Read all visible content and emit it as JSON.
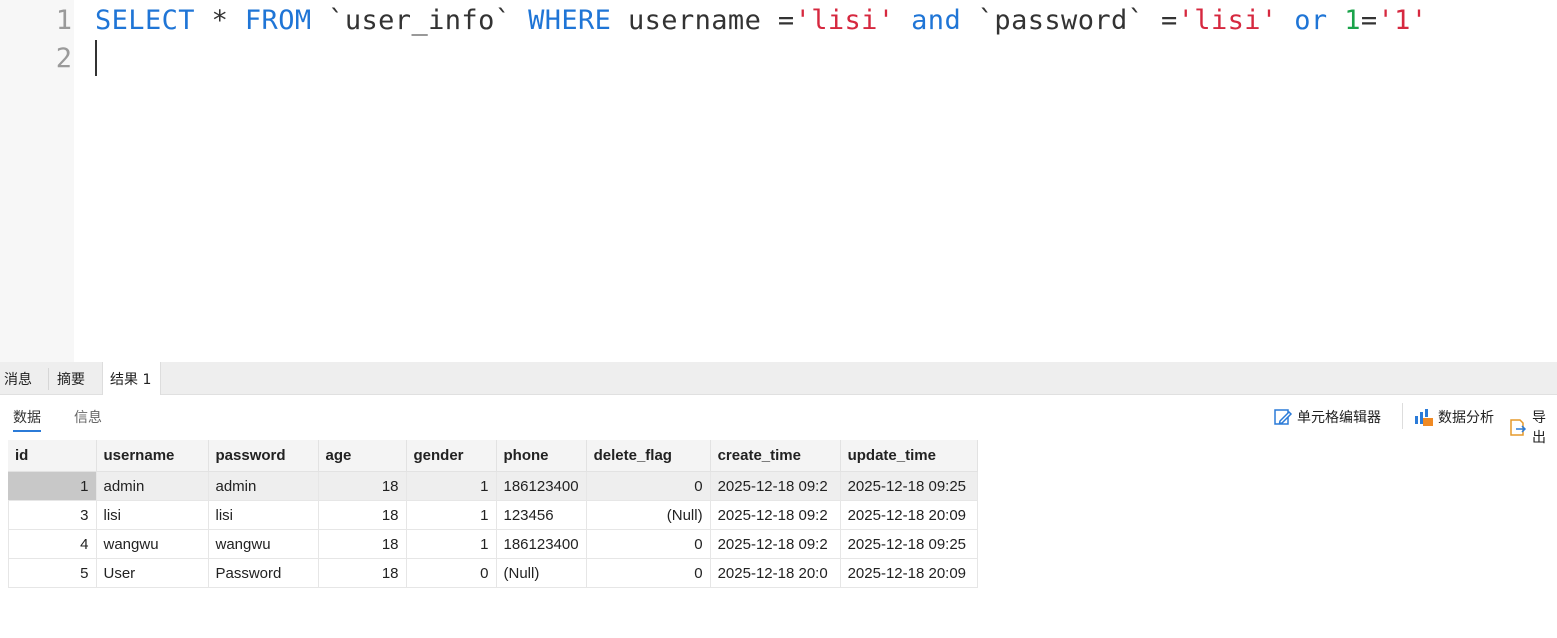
{
  "editor": {
    "line_numbers": [
      "1",
      "2"
    ],
    "tokens": [
      {
        "t": "SELECT",
        "c": "kw"
      },
      {
        "t": " * ",
        "c": ""
      },
      {
        "t": "FROM",
        "c": "kw"
      },
      {
        "t": " `user_info` ",
        "c": ""
      },
      {
        "t": "WHERE",
        "c": "kw"
      },
      {
        "t": " username =",
        "c": ""
      },
      {
        "t": "'lisi'",
        "c": "str"
      },
      {
        "t": " ",
        "c": ""
      },
      {
        "t": "and",
        "c": "kw"
      },
      {
        "t": " `password` =",
        "c": ""
      },
      {
        "t": "'lisi'",
        "c": "str"
      },
      {
        "t": " ",
        "c": ""
      },
      {
        "t": "or",
        "c": "kw"
      },
      {
        "t": " ",
        "c": ""
      },
      {
        "t": "1",
        "c": "num"
      },
      {
        "t": "=",
        "c": ""
      },
      {
        "t": "'1'",
        "c": "str"
      }
    ]
  },
  "result_tabs": {
    "messages": "消息",
    "summary": "摘要",
    "result1": "结果 1"
  },
  "sub_tabs": {
    "data": "数据",
    "info": "信息"
  },
  "toolbar": {
    "cell_editor": "单元格编辑器",
    "data_analysis": "数据分析",
    "export": "导出"
  },
  "grid": {
    "columns": [
      "id",
      "username",
      "password",
      "age",
      "gender",
      "phone",
      "delete_flag",
      "create_time",
      "update_time"
    ],
    "rows": [
      [
        "1",
        "admin",
        "admin",
        "18",
        "1",
        "186123400",
        "0",
        "2025-12-18 09:2",
        "2025-12-18 09:25"
      ],
      [
        "3",
        "lisi",
        "lisi",
        "18",
        "1",
        "123456",
        "(Null)",
        "2025-12-18 09:2",
        "2025-12-18 20:09"
      ],
      [
        "4",
        "wangwu",
        "wangwu",
        "18",
        "1",
        "186123400",
        "0",
        "2025-12-18 09:2",
        "2025-12-18 09:25"
      ],
      [
        "5",
        "User",
        "Password",
        "18",
        "0",
        "(Null)",
        "0",
        "2025-12-18 20:0",
        "2025-12-18 20:09"
      ]
    ]
  },
  "colors": {
    "keyword": "#1f75d6",
    "string": "#d6283f",
    "number": "#1aa34a",
    "null": "#aab0bd",
    "active_underline": "#2b7bd8"
  }
}
